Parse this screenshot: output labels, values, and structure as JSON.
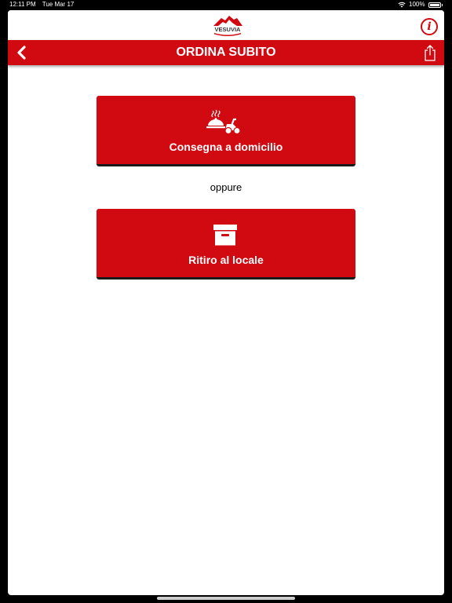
{
  "status_bar": {
    "time": "12:11 PM",
    "date": "Tue Mar 17",
    "battery": "100%",
    "icons": [
      "wifi-icon",
      "battery-icon"
    ]
  },
  "header": {
    "logo_text": "VESUVIA",
    "info_label": "i",
    "title": "ORDINA SUBITO",
    "icons": [
      "chevron-left-icon",
      "share-icon",
      "info-icon"
    ]
  },
  "options": {
    "delivery": {
      "label": "Consegna a domicilio",
      "icon": "scooter-delivery-icon"
    },
    "separator": "oppure",
    "pickup": {
      "label": "Ritiro al locale",
      "icon": "archive-box-icon"
    }
  },
  "colors": {
    "accent": "#d10a12",
    "background": "#ffffff",
    "text": "#000000"
  }
}
